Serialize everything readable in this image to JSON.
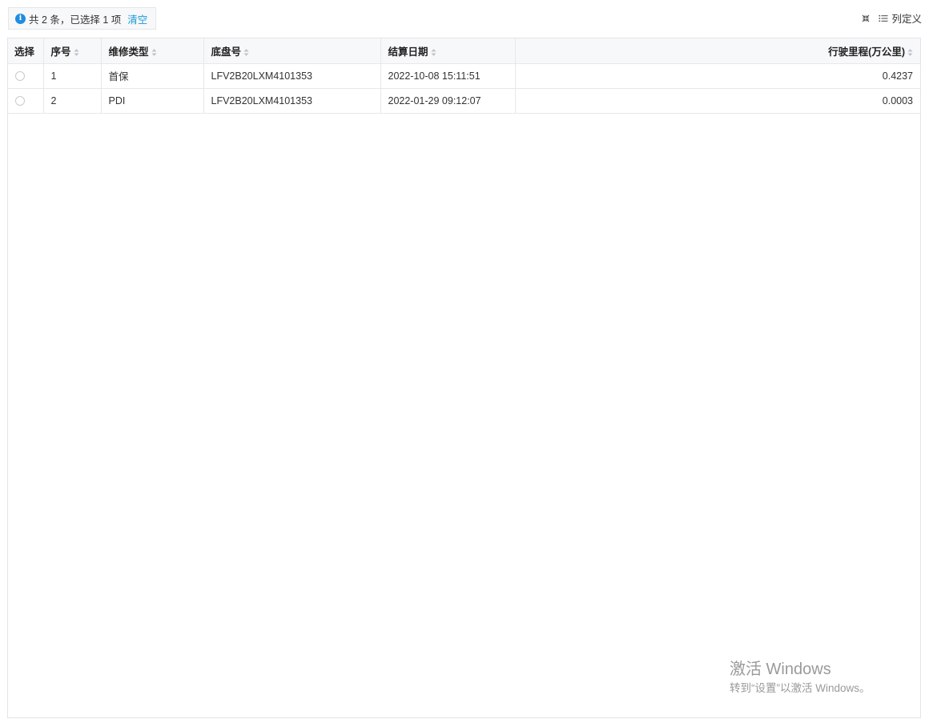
{
  "info_bar": {
    "icon": "info-icon",
    "summary": "共 2 条，已选择 1 项",
    "clear_label": "清空"
  },
  "toolbar": {
    "collapse_icon": "collapse-icon",
    "column_icon": "list-icon",
    "column_settings_label": "列定义"
  },
  "table": {
    "columns": [
      {
        "label": "选择",
        "sortable": false
      },
      {
        "label": "序号",
        "sortable": true
      },
      {
        "label": "维修类型",
        "sortable": true
      },
      {
        "label": "底盘号",
        "sortable": true
      },
      {
        "label": "结算日期",
        "sortable": true
      },
      {
        "label": "行驶里程(万公里)",
        "sortable": true
      }
    ],
    "rows": [
      {
        "seq": "1",
        "type": "首保",
        "vin": "LFV2B20LXM4101353",
        "date": "2022-10-08 15:11:51",
        "mileage": "0.4237"
      },
      {
        "seq": "2",
        "type": "PDI",
        "vin": "LFV2B20LXM4101353",
        "date": "2022-01-29 09:12:07",
        "mileage": "0.0003"
      }
    ]
  },
  "watermark": {
    "title": "激活 Windows",
    "subtitle": "转到“设置”以激活 Windows。"
  }
}
